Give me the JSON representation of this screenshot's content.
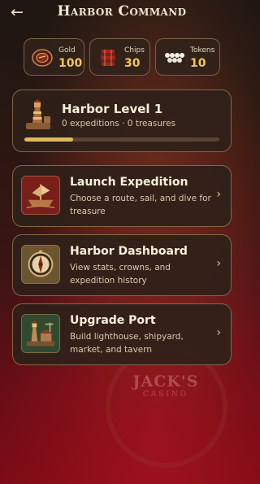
{
  "header": {
    "title": "Harbor Command",
    "back_icon": "arrow-left-icon"
  },
  "stats": [
    {
      "label": "Gold",
      "value": "100",
      "icon": "gold-coin-icon"
    },
    {
      "label": "Chips",
      "value": "30",
      "icon": "chip-stack-icon"
    },
    {
      "label": "Tokens",
      "value": "10",
      "icon": "pearl-tokens-icon"
    }
  ],
  "level": {
    "title": "Harbor Level 1",
    "subtitle": "0 expeditions · 0 treasures",
    "progress_fraction": 0.25,
    "icon": "lighthouse-icon"
  },
  "menu": [
    {
      "title": "Launch Expedition",
      "desc": "Choose a route, sail, and dive for treasure",
      "icon": "ship-icon"
    },
    {
      "title": "Harbor Dashboard",
      "desc": "View stats, crowns, and expedition history",
      "icon": "compass-icon"
    },
    {
      "title": "Upgrade Port",
      "desc": "Build lighthouse, shipyard, market, and tavern",
      "icon": "port-icon"
    }
  ],
  "background_brand": {
    "name": "JACK'S",
    "sub": "CASINO"
  },
  "colors": {
    "accent_gold": "#f2c75b",
    "card_border": "#af8c5f",
    "progress_fill": "#e0b85a"
  }
}
